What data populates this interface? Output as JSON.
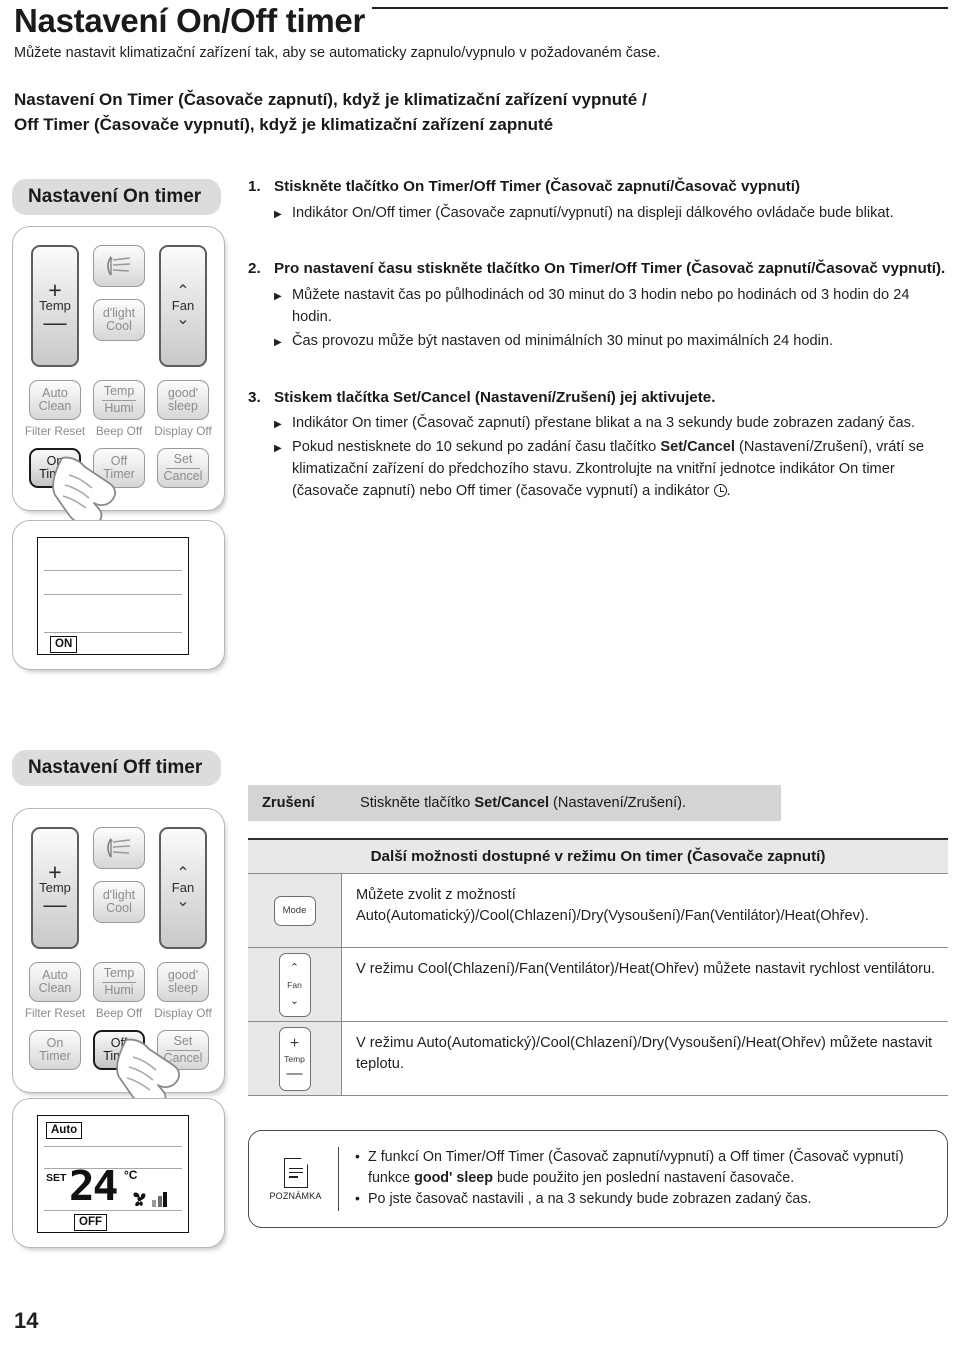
{
  "header": {
    "title": "Nastavení On/Off timer",
    "subtitle": "Můžete nastavit klimatizační zařízení tak, aby se automaticky zapnulo/vypnulo v požadovaném čase.",
    "lead_line1": "Nastavení On Timer (Časovače zapnutí), když je klimatizační zařízení vypnuté /",
    "lead_line2": "Off Timer (Časovače vypnutí), když je klimatizační zařízení zapnuté"
  },
  "sections": {
    "on_timer_pill": "Nastavení On timer",
    "off_timer_pill": "Nastavení Off timer"
  },
  "remote": {
    "temp_label": "Temp",
    "plus": "+",
    "minus": "—",
    "fan_label": "Fan",
    "chev_up": "⌃",
    "chev_down": "⌄",
    "dlight_line1": "d'light",
    "dlight_line2": "Cool",
    "auto_clean_l1": "Auto",
    "auto_clean_l2": "Clean",
    "temp_humi_l1": "Temp",
    "temp_humi_l2": "Humi",
    "good_sleep_l1": "good'",
    "good_sleep_l2": "sleep",
    "filter_reset": "Filter Reset",
    "beep_off": "Beep Off",
    "display_off": "Display Off",
    "on_timer_l1": "On",
    "on_timer_l2": "Timer",
    "off_timer_l1": "Off",
    "off_timer_l2": "Timer",
    "set_cancel_l1": "Set",
    "set_cancel_l2": "Cancel"
  },
  "lcd_on": {
    "on_badge": "ON"
  },
  "lcd_off": {
    "auto_badge": "Auto",
    "set_label": "SET",
    "temperature": "24",
    "degree_unit": "°C",
    "off_badge": "OFF",
    "fan_icon": "fan-icon"
  },
  "steps": [
    {
      "number": "1.",
      "heading": "Stiskněte tlačítko On Timer/Off Timer (Časovač zapnutí/Časovač vypnutí)",
      "bullets": [
        "Indikátor On/Off timer (Časovače zapnutí/vypnutí) na displeji dálkového ovládače bude blikat."
      ]
    },
    {
      "number": "2.",
      "heading": "Pro nastavení času stiskněte tlačítko On Timer/Off Timer (Časovač zapnutí/Časovač vypnutí).",
      "bullets": [
        "Můžete nastavit čas po půlhodinách od 30 minut do 3 hodin nebo po hodinách od 3 hodin do 24 hodin.",
        "Čas provozu může být nastaven od minimálních 30 minut po maximálních 24 hodin."
      ]
    },
    {
      "number": "3.",
      "heading_pre": "Stiskem tlačítka ",
      "heading_bold": "Set/Cancel",
      "heading_post": " (Nastavení/Zrušení) jej aktivujete.",
      "bullets": [
        "Indikátor On timer (Časovač zapnutí) přestane blikat a na 3 sekundy bude zobrazen zadaný čas."
      ],
      "bullet2_pre": "Pokud nestisknete do 10 sekund po zadání času tlačítko ",
      "bullet2_bold": "Set/Cancel",
      "bullet2_post": " (Nastavení/Zrušení), vrátí se klimatizační zařízení do předchozího stavu. Zkontrolujte na vnitřní jednotce indikátor On timer (časovače zapnutí) nebo Off timer (časovače vypnutí) a indikátor "
    }
  ],
  "cancel_bar": {
    "label": "Zrušení",
    "text_pre": "Stiskněte tlačítko ",
    "text_bold": "Set/Cancel",
    "text_post": " (Nastavení/Zrušení)."
  },
  "options_table": {
    "title": "Další možnosti dostupné v režimu On timer (Časovače zapnutí)",
    "rows": [
      {
        "icon": "mode-button-icon",
        "icon_label": "Mode",
        "text": "Můžete zvolit z možností Auto(Automatický)/Cool(Chlazení)/Dry(Vysoušení)/Fan(Ventilátor)/Heat(Ohřev)."
      },
      {
        "icon": "fan-button-icon",
        "icon_label": "Fan",
        "text": "V režimu Cool(Chlazení)/Fan(Ventilátor)/Heat(Ohřev) můžete nastavit rychlost ventilátoru."
      },
      {
        "icon": "temp-button-icon",
        "icon_label": "Temp",
        "text": "V režimu Auto(Automatický)/Cool(Chlazení)/Dry(Vysoušení)/Heat(Ohřev) můžete nastavit teplotu."
      }
    ]
  },
  "note": {
    "caption": "POZNÁMKA",
    "item1_pre": "Z funkcí On Timer/Off Timer (Časovač zapnutí/vypnutí) a Off timer (Časovač vypnutí) funkce ",
    "item1_bold": "good' sleep",
    "item1_post": " bude použito jen poslední nastavení časovače.",
    "item2": "Po jste časovač nastavili , a na 3 sekundy bude zobrazen zadaný čas."
  },
  "footer": {
    "page_number": "14"
  },
  "colors": {
    "pill_bg": "#dcdcdc",
    "band_bg": "#d4d4d4",
    "table_head_bg": "#e8e8e8",
    "text": "#231f20"
  }
}
